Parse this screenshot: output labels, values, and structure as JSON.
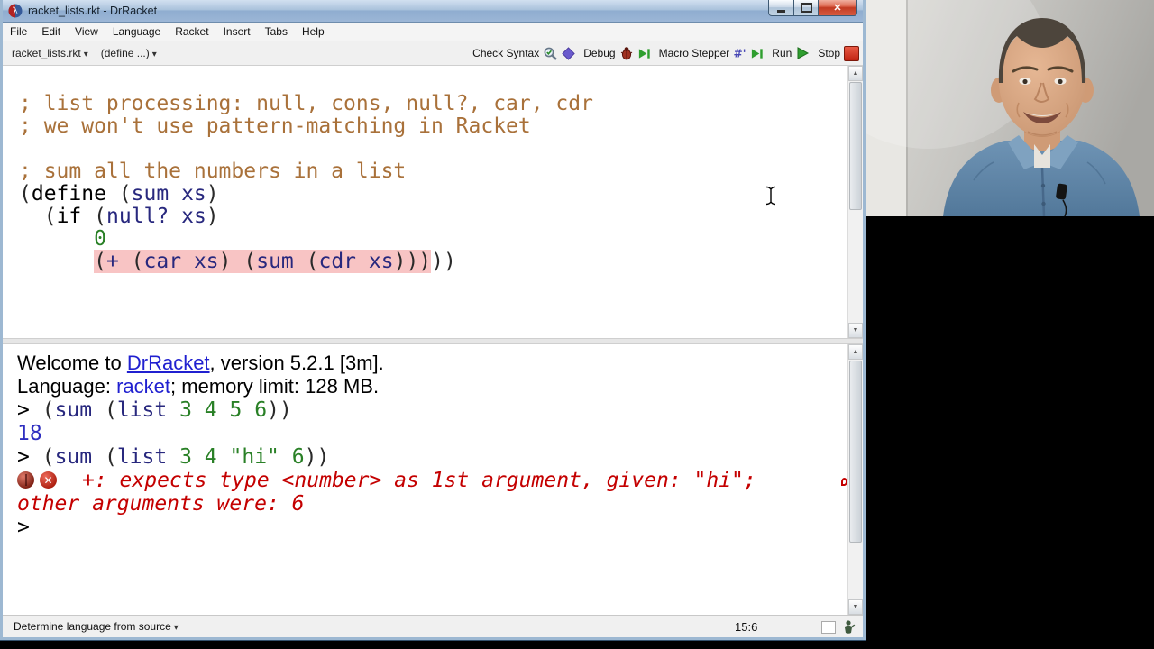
{
  "window": {
    "title": "racket_lists.rkt - DrRacket"
  },
  "menubar": {
    "items": [
      "File",
      "Edit",
      "View",
      "Language",
      "Racket",
      "Insert",
      "Tabs",
      "Help"
    ]
  },
  "toolbar": {
    "filename_dropdown": "racket_lists.rkt",
    "definition_dropdown": "(define ...)",
    "check_syntax_label": "Check Syntax",
    "debug_label": "Debug",
    "macro_stepper_label": "Macro Stepper",
    "run_label": "Run",
    "stop_label": "Stop"
  },
  "editor": {
    "lines": [
      {
        "segs": [
          [
            "; list processing: null, cons, null?, car, cdr",
            "comment"
          ]
        ]
      },
      {
        "segs": [
          [
            "; we won't use pattern-matching in Racket",
            "comment"
          ]
        ]
      },
      {
        "segs": []
      },
      {
        "segs": [
          [
            "; sum all the numbers in a list",
            "comment"
          ]
        ]
      },
      {
        "segs": [
          [
            "(",
            "paren"
          ],
          [
            "define",
            "keyword"
          ],
          [
            " ",
            "plain"
          ],
          [
            "(",
            "paren"
          ],
          [
            "sum",
            "identifier"
          ],
          [
            " ",
            "plain"
          ],
          [
            "xs",
            "identifier"
          ],
          [
            ")",
            "paren"
          ]
        ]
      },
      {
        "segs": [
          [
            "  ",
            "plain"
          ],
          [
            "(",
            "paren"
          ],
          [
            "if",
            "keyword"
          ],
          [
            " ",
            "plain"
          ],
          [
            "(",
            "paren"
          ],
          [
            "null?",
            "identifier"
          ],
          [
            " ",
            "plain"
          ],
          [
            "xs",
            "identifier"
          ],
          [
            ")",
            "paren"
          ]
        ]
      },
      {
        "segs": [
          [
            "      ",
            "plain"
          ],
          [
            "0",
            "constant"
          ]
        ]
      },
      {
        "segs": [
          [
            "      ",
            "plain"
          ],
          [
            "(",
            "paren",
            true
          ],
          [
            "+",
            "identifier",
            true
          ],
          [
            " ",
            "plain",
            true
          ],
          [
            "(",
            "paren",
            true
          ],
          [
            "car",
            "identifier",
            true
          ],
          [
            " ",
            "plain",
            true
          ],
          [
            "xs",
            "identifier",
            true
          ],
          [
            ")",
            "paren",
            true
          ],
          [
            " ",
            "plain",
            true
          ],
          [
            "(",
            "paren",
            true
          ],
          [
            "sum",
            "identifier",
            true
          ],
          [
            " ",
            "plain",
            true
          ],
          [
            "(",
            "paren",
            true
          ],
          [
            "cdr",
            "identifier",
            true
          ],
          [
            " ",
            "plain",
            true
          ],
          [
            "xs",
            "identifier",
            true
          ],
          [
            ")))",
            "paren",
            true
          ],
          [
            "))",
            "paren"
          ]
        ]
      }
    ]
  },
  "repl": {
    "lines": [
      {
        "font": "sans",
        "segs": [
          [
            "Welcome to ",
            "plain"
          ],
          [
            "DrRacket",
            "link"
          ],
          [
            ", version 5.2.1 [3m].",
            "plain"
          ]
        ]
      },
      {
        "font": "sans",
        "segs": [
          [
            "Language: ",
            "plain"
          ],
          [
            "racket",
            "lang"
          ],
          [
            "; memory limit: 128 MB.",
            "plain"
          ]
        ]
      },
      {
        "font": "mono",
        "segs": [
          [
            "> ",
            "prompt"
          ],
          [
            "(",
            "paren"
          ],
          [
            "sum",
            "identifier"
          ],
          [
            " ",
            "plain"
          ],
          [
            "(",
            "paren"
          ],
          [
            "list",
            "identifier"
          ],
          [
            " ",
            "plain"
          ],
          [
            "3",
            "constant"
          ],
          [
            " ",
            "plain"
          ],
          [
            "4",
            "constant"
          ],
          [
            " ",
            "plain"
          ],
          [
            "5",
            "constant"
          ],
          [
            " ",
            "plain"
          ],
          [
            "6",
            "constant"
          ],
          [
            "))",
            "paren"
          ]
        ]
      },
      {
        "font": "mono",
        "segs": [
          [
            "18",
            "result"
          ]
        ]
      },
      {
        "font": "mono",
        "segs": [
          [
            "> ",
            "prompt"
          ],
          [
            "(",
            "paren"
          ],
          [
            "sum",
            "identifier"
          ],
          [
            " ",
            "plain"
          ],
          [
            "(",
            "paren"
          ],
          [
            "list",
            "identifier"
          ],
          [
            " ",
            "plain"
          ],
          [
            "3",
            "constant"
          ],
          [
            " ",
            "plain"
          ],
          [
            "4",
            "constant"
          ],
          [
            " ",
            "plain"
          ],
          [
            "\"hi\"",
            "string"
          ],
          [
            " ",
            "plain"
          ],
          [
            "6",
            "constant"
          ],
          [
            "))",
            "paren"
          ]
        ]
      },
      {
        "font": "mono",
        "icons": [
          "bug-report-icon",
          "error-x-icon"
        ],
        "segs": [
          [
            "+: expects type <number> as 1st argument, given: \"hi\";",
            "error"
          ]
        ]
      },
      {
        "font": "mono",
        "segs": [
          [
            "other arguments were: 6",
            "error"
          ]
        ]
      },
      {
        "font": "mono",
        "segs": [
          [
            ">",
            "prompt"
          ]
        ]
      }
    ]
  },
  "statusbar": {
    "language_selector": "Determine language from source",
    "caret_position": "15:6"
  },
  "colors": {
    "comment": "#a9713a",
    "identifier": "#28287e",
    "constant_green": "#298026",
    "error_red": "#c40000",
    "result_blue": "#2e2ec0",
    "link_blue": "#2020d0",
    "error_highlight_pink": "#f8c4c4",
    "titlebar_blue": "#9cb6d6",
    "run_green": "#2f9e2f",
    "stop_red": "#c02312"
  }
}
